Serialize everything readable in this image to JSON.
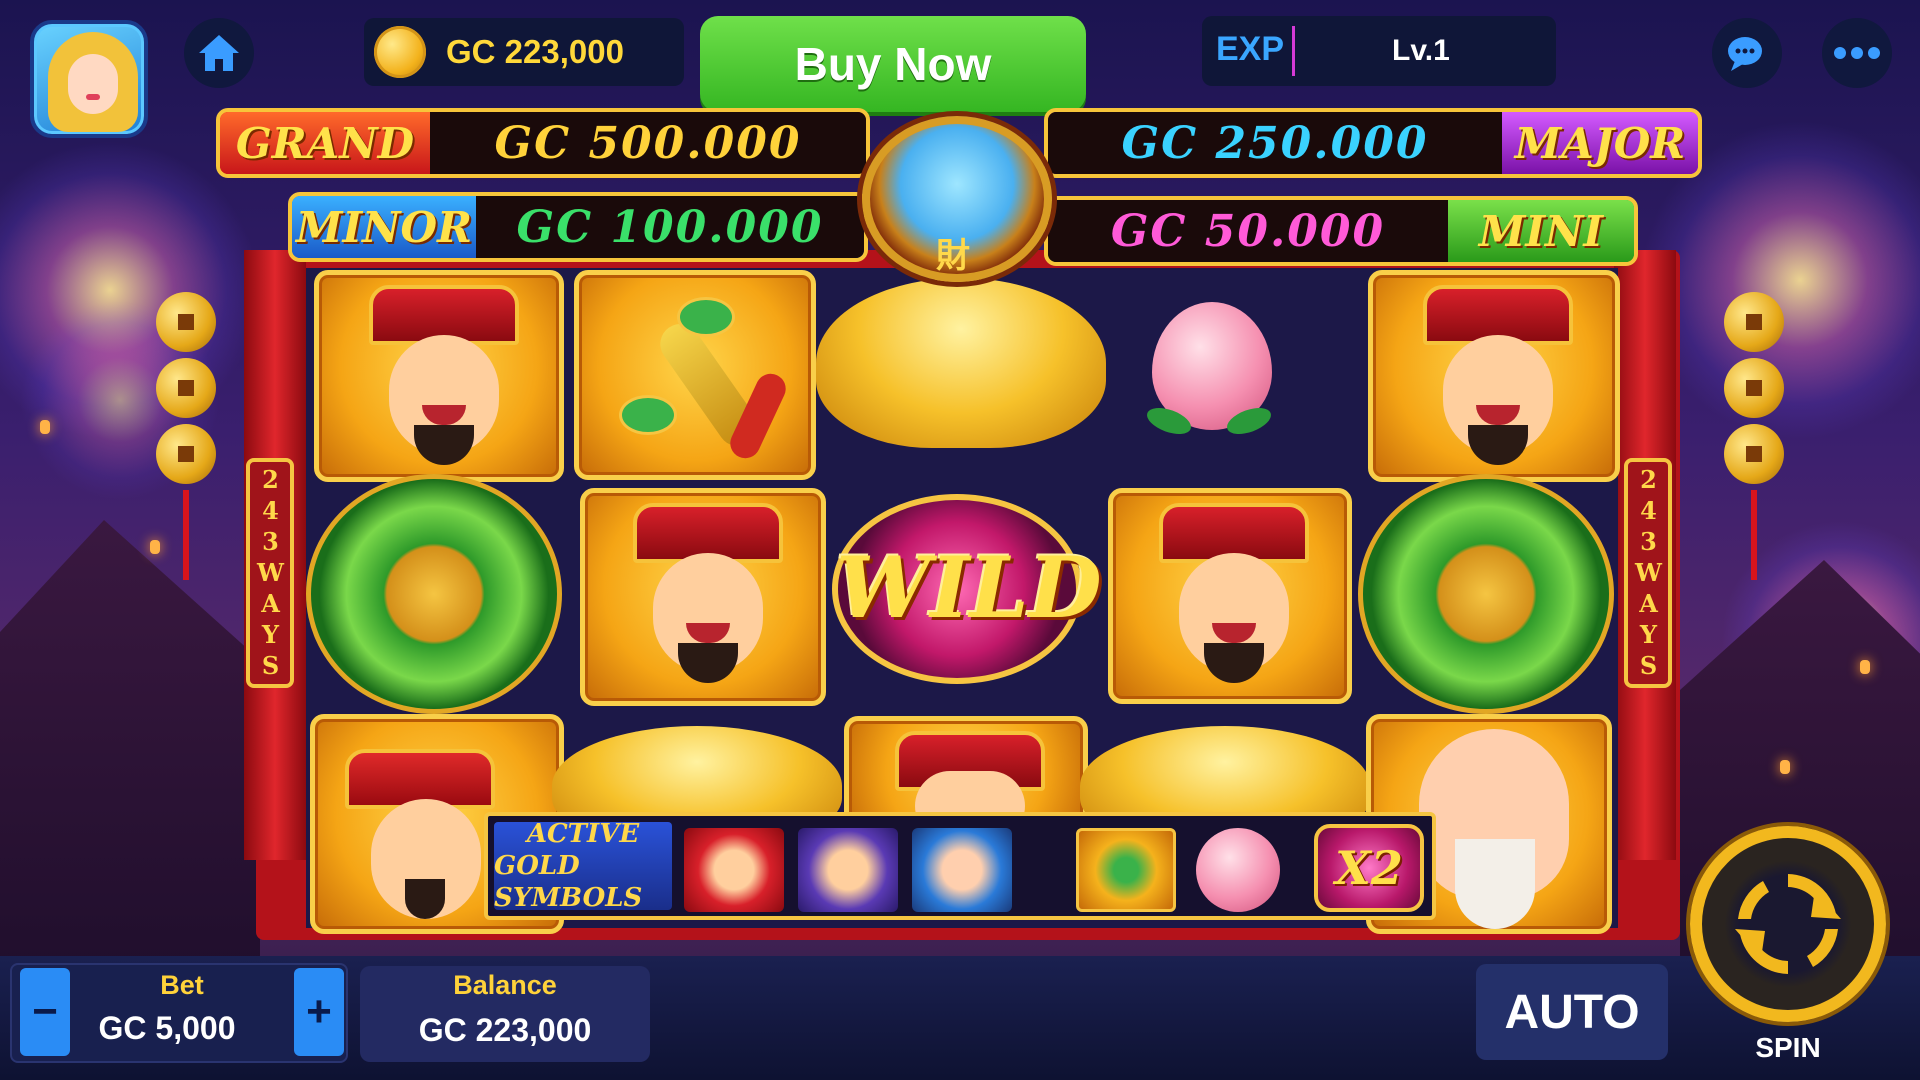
{
  "topbar": {
    "gc_balance": "GC 223,000",
    "buy_now_label": "Buy Now",
    "exp_label": "EXP",
    "level_label": "Lv.1",
    "icons": [
      "home-icon",
      "chat-icon",
      "more-icon"
    ]
  },
  "jackpots": {
    "grand": {
      "tag": "GRAND",
      "value": "GC 500.000"
    },
    "major": {
      "tag": "MAJOR",
      "value": "GC 250.000"
    },
    "minor": {
      "tag": "MINOR",
      "value": "GC 100.000"
    },
    "mini": {
      "tag": "MINI",
      "value": "GC 50.000"
    }
  },
  "side_plaque": "243WAYS",
  "reels": {
    "wild_label": "WILD"
  },
  "active_gold_symbols": {
    "line1": "ACTIVE",
    "line2": "GOLD SYMBOLS",
    "multiplier": "X2"
  },
  "bottombar": {
    "bet_label": "Bet",
    "bet_value": "GC 5,000",
    "minus_label": "−",
    "plus_label": "+",
    "balance_label": "Balance",
    "balance_value": "GC 223,000",
    "auto_label": "AUTO",
    "spin_label": "SPIN"
  },
  "colors": {
    "gold": "#ffd83a",
    "buy_green": "#35b622",
    "exp_blue": "#3aa6ff",
    "grand_value": "#ffd23a",
    "major_value": "#3ad2ff",
    "minor_value": "#3ae06a",
    "mini_value": "#ff5ad8"
  }
}
